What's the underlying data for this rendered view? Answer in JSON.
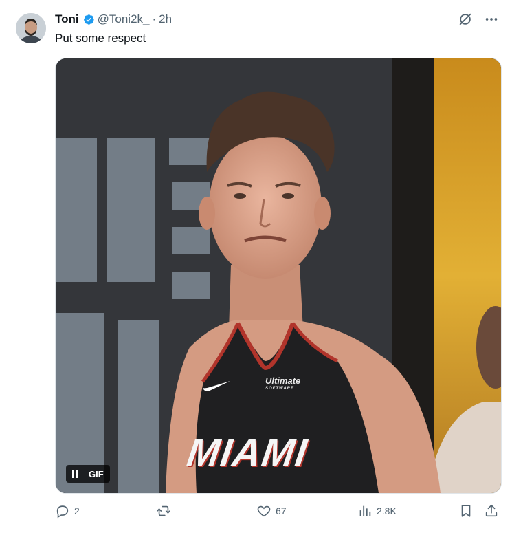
{
  "author": {
    "name": "Toni",
    "handle": "@Toni2k_",
    "separator": "·",
    "time": "2h",
    "verified": true
  },
  "tweet": {
    "text": "Put some respect"
  },
  "media": {
    "type": "gif",
    "badge": "GIF",
    "jersey_text": "MIAMI",
    "sponsor_text": "Ultimate",
    "sponsor_sub": "SOFTWARE"
  },
  "actions": {
    "replies": "2",
    "reposts": "",
    "likes": "67",
    "views": "2.8K"
  },
  "icons": [
    "avatar",
    "verified-badge-icon",
    "grok-icon",
    "more-icon",
    "reply-icon",
    "repost-icon",
    "like-icon",
    "views-icon",
    "bookmark-icon",
    "share-icon",
    "pause-icon"
  ],
  "colors": {
    "accent": "#1d9bf0",
    "text": "#0f1419",
    "muted": "#536471"
  }
}
